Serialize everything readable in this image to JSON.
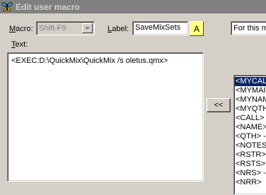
{
  "window": {
    "title": "Edit user macro",
    "icon": "butterfly-icon"
  },
  "form": {
    "macro_label": "Macro:",
    "macro_value": "Shift-F9",
    "label_label": "Label:",
    "label_value": "SaveMixSets",
    "a_button": "A",
    "for_this_text": "For this m",
    "text_label": "Text:",
    "text_value": "<EXEC:D:\\QuickMix\\QuickMix /s oletus.qmx>",
    "insert_button": "<<"
  },
  "list": {
    "items": [
      "<MYCAL",
      "<MYMAI",
      "<MYNAM",
      "<MYQTH",
      "<CALL>",
      "<NAME>",
      "<QTH> -",
      "<NOTES",
      "<RSTR>",
      "<RSTS>",
      "<NRS> -",
      "<NRR>"
    ],
    "selected_index": 0
  },
  "colors": {
    "face": "#d4d0c8",
    "titlebar": "#808080",
    "selection": "#0a246a",
    "a_button_bg": "#ffff80"
  }
}
